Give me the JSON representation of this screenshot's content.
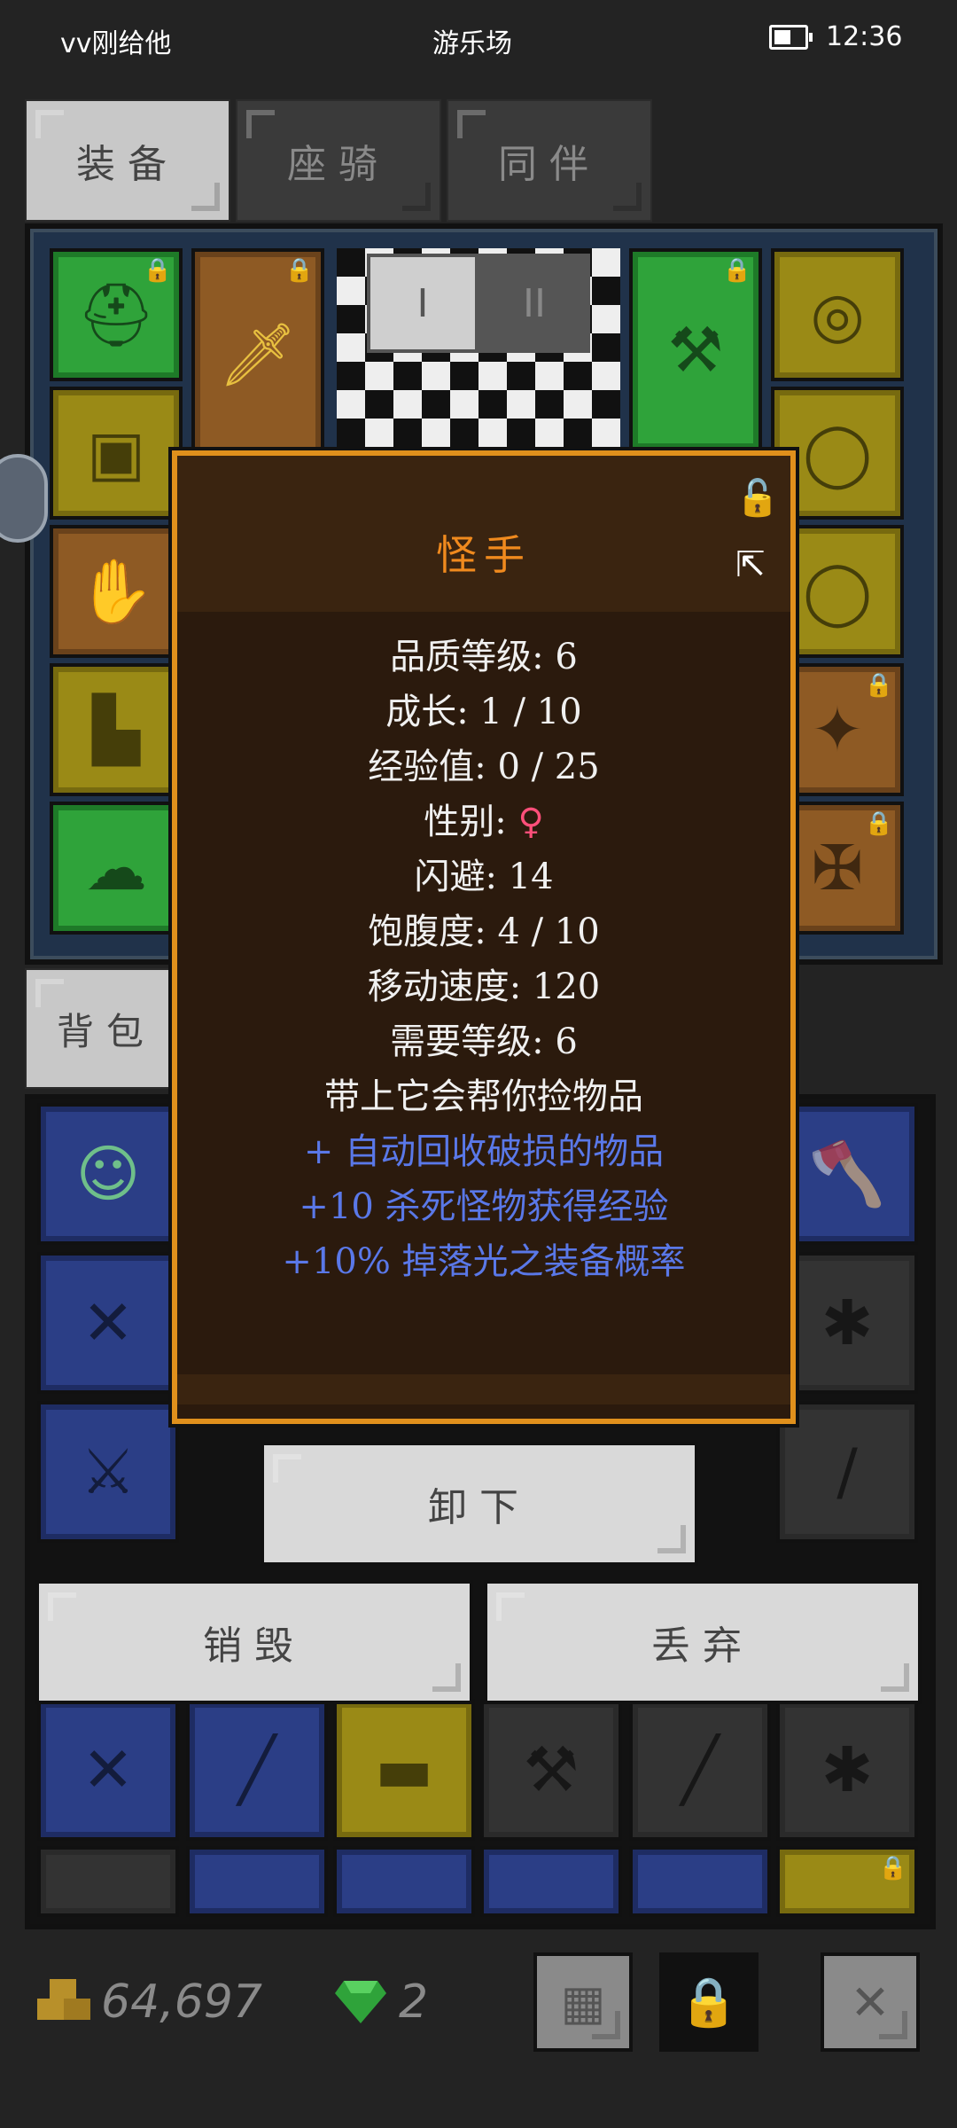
{
  "status_bar": {
    "carrier": "vv刚给他",
    "center": "游乐场",
    "time": "12:36"
  },
  "tabs": [
    {
      "label": "装备",
      "active": true
    },
    {
      "label": "座骑",
      "active": false
    },
    {
      "label": "同伴",
      "active": false
    }
  ],
  "pet_tabs": [
    "I",
    "II"
  ],
  "backpack_tab": {
    "label": "背包"
  },
  "modal": {
    "title": "怪手",
    "stats": [
      {
        "label": "品质等级: 6"
      },
      {
        "label": "成长: 1 / 10"
      },
      {
        "label": "经验值: 0 / 25"
      },
      {
        "label": "性别: ",
        "symbol": "♀"
      },
      {
        "label": "闪避: 14"
      },
      {
        "label": "饱腹度: 4 / 10"
      },
      {
        "label": "移动速度: 120"
      },
      {
        "label": "需要等级: 6"
      },
      {
        "label": "带上它会帮你捡物品"
      }
    ],
    "bonuses": [
      "+ 自动回收破损的物品",
      "+10 杀死怪物获得经验",
      "+10% 掉落光之装备概率"
    ]
  },
  "actions": {
    "unequip": "卸下",
    "destroy": "销毁",
    "discard": "丢弃"
  },
  "currency": {
    "gold": "64,697",
    "gems": "2"
  },
  "colors": {
    "modal_border": "#e0901c",
    "title": "#f08a1e",
    "bonus_text": "#5a78e8",
    "female_symbol": "#ff4f7a"
  }
}
